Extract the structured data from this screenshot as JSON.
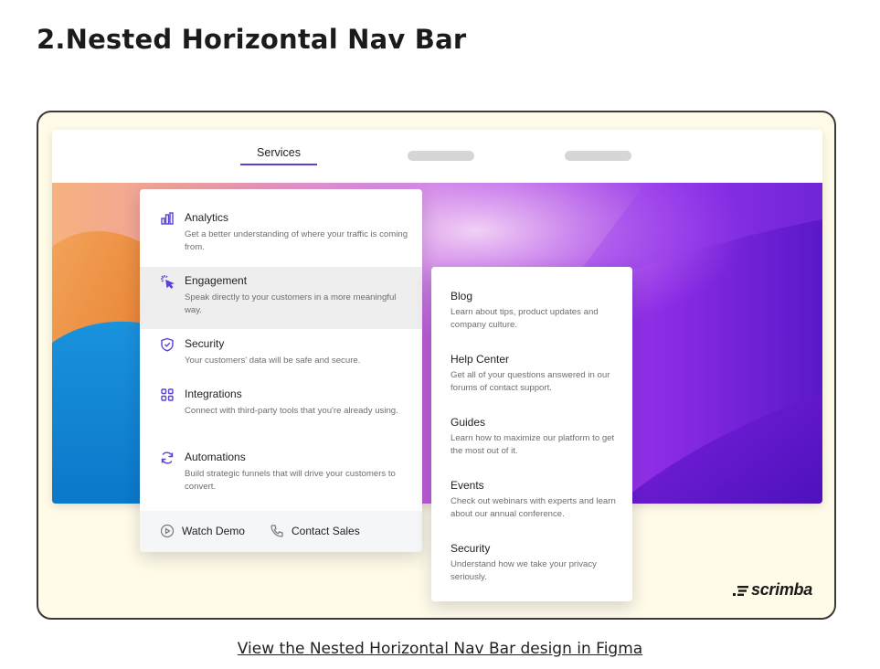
{
  "page": {
    "heading": "2.Nested Horizontal Nav Bar",
    "figma_link": "View the Nested Horizontal Nav Bar design in Figma"
  },
  "nav": {
    "active_tab": "Services"
  },
  "menu_main": {
    "items": [
      {
        "title": "Analytics",
        "description": "Get a better understanding of where your traffic is coming from.",
        "icon": "bar-chart-icon"
      },
      {
        "title": "Engagement",
        "description": "Speak directly to your customers in a more meaningful way.",
        "icon": "cursor-click-icon"
      },
      {
        "title": "Security",
        "description": "Your customers' data will be safe and secure.",
        "icon": "shield-check-icon"
      },
      {
        "title": "Integrations",
        "description": "Connect with third-party tools that you're already using.",
        "icon": "grid-icon"
      },
      {
        "title": "Automations",
        "description": "Build strategic funnels that will drive your customers to convert.",
        "icon": "refresh-icon"
      }
    ],
    "footer": {
      "watch_demo": "Watch Demo",
      "contact_sales": "Contact Sales"
    }
  },
  "menu_sub": {
    "items": [
      {
        "title": "Blog",
        "description": "Learn about tips, product updates and company culture."
      },
      {
        "title": "Help Center",
        "description": "Get all of your questions answered in our forums of contact support."
      },
      {
        "title": "Guides",
        "description": "Learn how to maximize our platform to get the most out of it."
      },
      {
        "title": "Events",
        "description": "Check out webinars with experts and learn about our annual conference."
      },
      {
        "title": "Security",
        "description": "Understand how we take your privacy seriously."
      }
    ]
  },
  "brand": {
    "logo_text": "scrimba",
    "accent": "#5b3fd6",
    "frame_bg": "#fffbe8"
  }
}
